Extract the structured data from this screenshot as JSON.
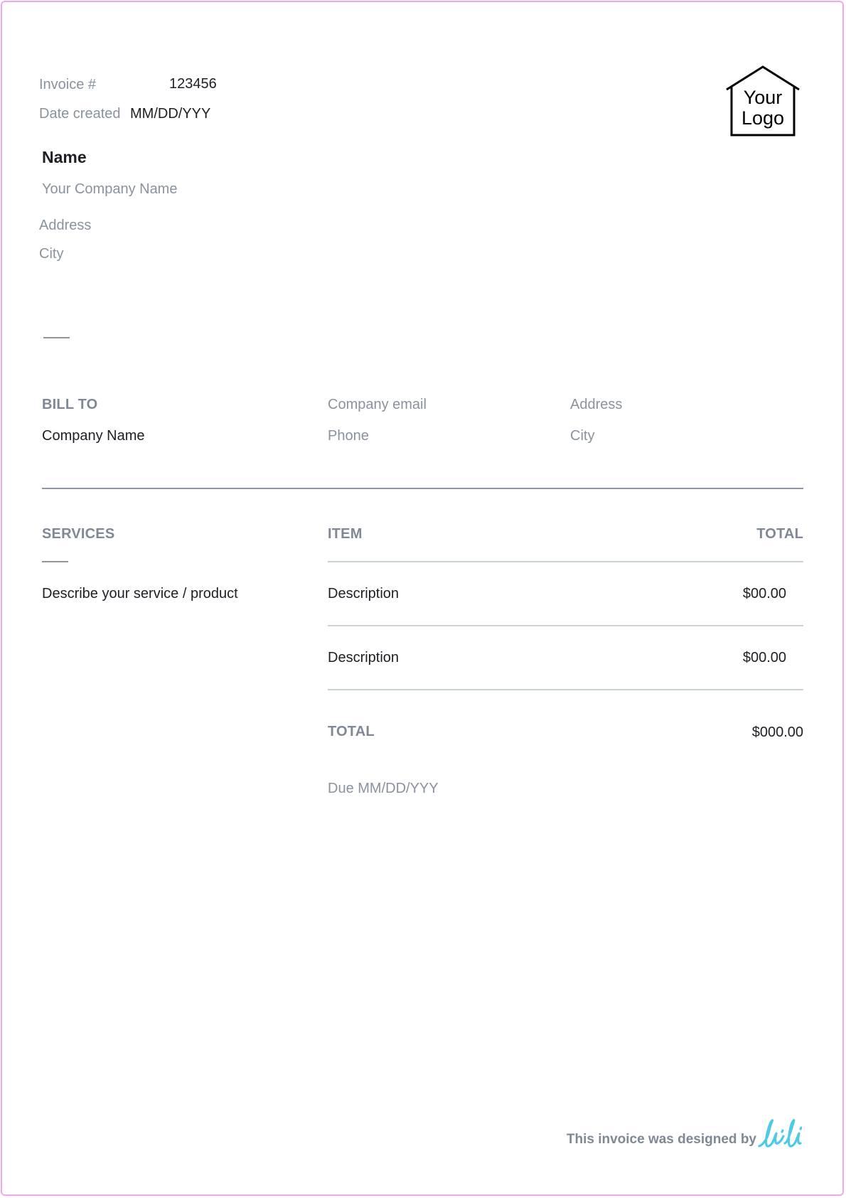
{
  "header": {
    "invoice_label": "Invoice #",
    "invoice_number": "123456",
    "date_label": "Date created",
    "date_value": "MM/DD/YYY"
  },
  "logo": {
    "line1": "Your",
    "line2": "Logo",
    "icon": "house-icon"
  },
  "sender": {
    "name": "Name",
    "company": "Your Company Name",
    "address": "Address",
    "city": "City"
  },
  "bill_to": {
    "heading": "BILL TO",
    "company_name": "Company Name",
    "email": "Company email",
    "phone": "Phone",
    "address": "Address",
    "city": "City"
  },
  "services": {
    "heading": "SERVICES",
    "description": "Describe your service / product"
  },
  "items_table": {
    "columns": [
      "ITEM",
      "TOTAL"
    ],
    "rows": [
      {
        "item": "Description",
        "total": "$00.00"
      },
      {
        "item": "Description",
        "total": "$00.00"
      }
    ],
    "total_label": "TOTAL",
    "total_value": "$000.00",
    "due": "Due MM/DD/YYY"
  },
  "footer": {
    "text": "This invoice was designed by",
    "brand": "lili"
  },
  "colors": {
    "page_border": "#f3a6ec",
    "muted_text": "#8a929e",
    "rule_dark": "#8f96a1",
    "rule_light": "#c9d1dc",
    "brand": "#4ec9e6"
  }
}
